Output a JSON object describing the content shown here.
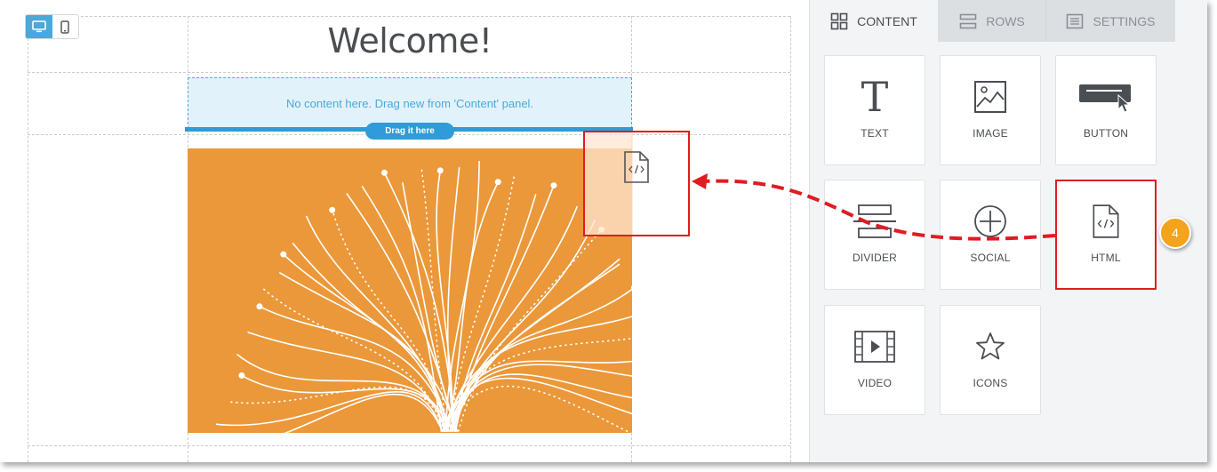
{
  "canvas": {
    "title": "Welcome!",
    "dropzone_text": "No content here. Drag new from 'Content' panel.",
    "drag_pill": "Drag it here"
  },
  "device_toggle": {
    "desktop_icon": "desktop-icon",
    "mobile_icon": "mobile-icon"
  },
  "panel": {
    "tabs": [
      {
        "label": "CONTENT",
        "icon": "grid-icon",
        "active": true
      },
      {
        "label": "ROWS",
        "icon": "rows-icon",
        "active": false
      },
      {
        "label": "SETTINGS",
        "icon": "settings-list-icon",
        "active": false
      }
    ],
    "tiles": [
      {
        "label": "TEXT",
        "icon": "text-icon"
      },
      {
        "label": "IMAGE",
        "icon": "image-icon"
      },
      {
        "label": "BUTTON",
        "icon": "button-icon"
      },
      {
        "label": "DIVIDER",
        "icon": "divider-icon"
      },
      {
        "label": "SOCIAL",
        "icon": "social-icon"
      },
      {
        "label": "HTML",
        "icon": "html-file-icon"
      },
      {
        "label": "VIDEO",
        "icon": "video-icon"
      },
      {
        "label": "ICONS",
        "icon": "star-icon"
      }
    ]
  },
  "annotation": {
    "step_number": "4"
  },
  "colors": {
    "accent_blue": "#2f9bd8",
    "highlight_red": "#e01b22",
    "hero_orange": "#eb983a",
    "badge_orange": "#f3a31c"
  }
}
